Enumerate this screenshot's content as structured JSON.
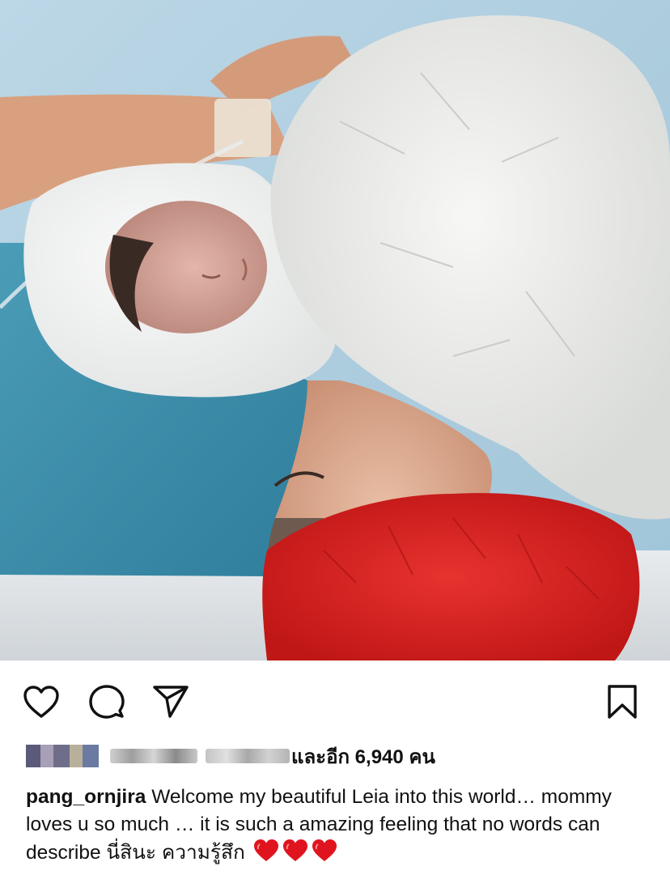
{
  "post": {
    "image_alt": "Mother in a white surgical cap and red hair net kissing a newborn baby wrapped in a white towel",
    "actions": {
      "like_icon": "heart-outline-icon",
      "comment_icon": "comment-bubble-icon",
      "share_icon": "paper-plane-icon",
      "save_icon": "bookmark-outline-icon"
    },
    "likes_text": "และอีก 6,940 คน",
    "caption": {
      "username": "pang_ornjira",
      "text": "Welcome my beautiful Leia into this world… mommy loves u so much … it is such a amazing feeling that no words can describe นี่สินะ ความรู้สึก",
      "emoji": [
        "red-heart",
        "red-heart",
        "red-heart"
      ]
    }
  },
  "colors": {
    "heart": "#e0141e",
    "text": "#111111",
    "background": "#ffffff"
  }
}
